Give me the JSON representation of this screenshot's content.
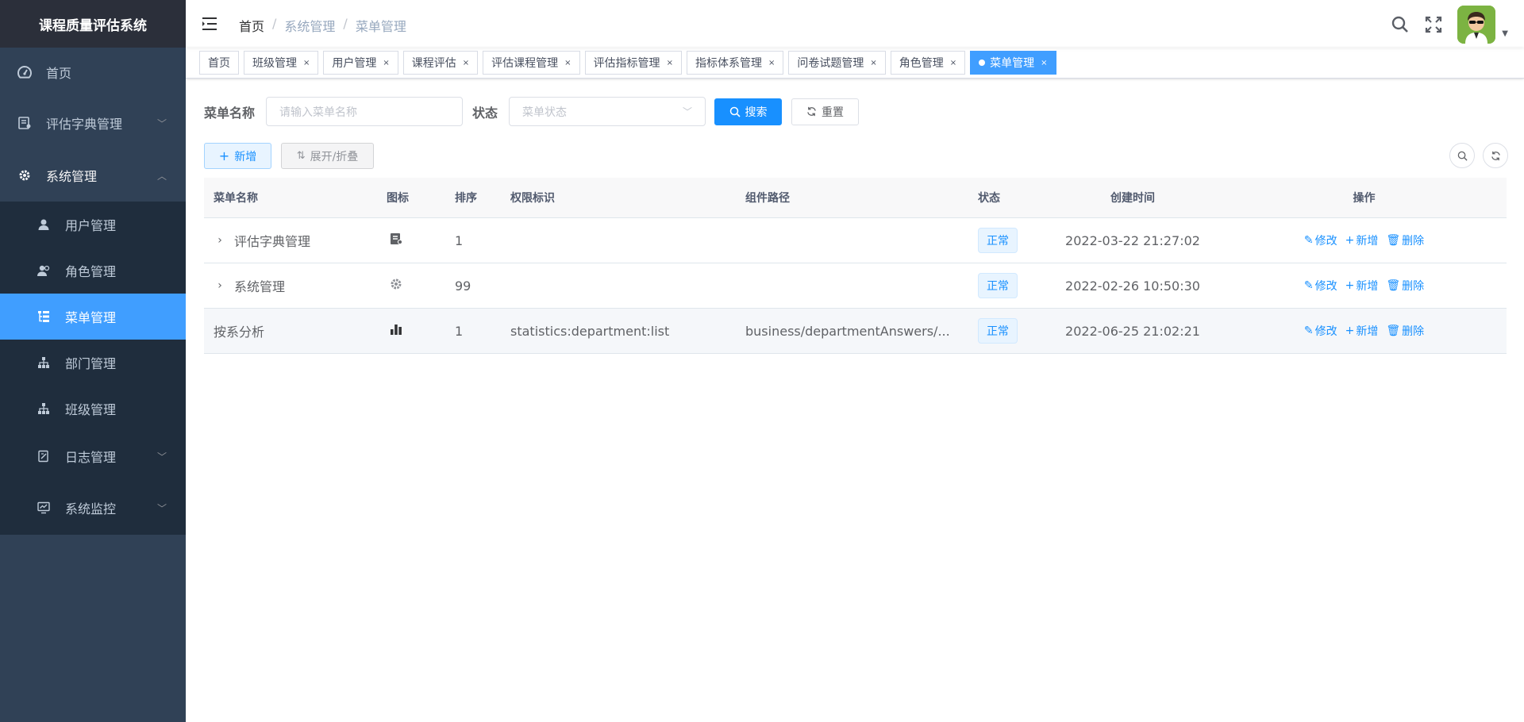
{
  "sidebar": {
    "logo": "课程质量评估系统",
    "items": [
      {
        "label": "首页",
        "icon": "dashboard-icon"
      },
      {
        "label": "评估字典管理",
        "icon": "dict-icon",
        "arrow": "﹀"
      },
      {
        "label": "系统管理",
        "icon": "gear-icon",
        "arrow": "︿"
      }
    ],
    "sub": [
      {
        "label": "用户管理",
        "icon": "user-icon"
      },
      {
        "label": "角色管理",
        "icon": "peoples-icon"
      },
      {
        "label": "菜单管理",
        "icon": "tree-table-icon"
      },
      {
        "label": "部门管理",
        "icon": "tree-icon"
      },
      {
        "label": "班级管理",
        "icon": "tree-icon"
      }
    ],
    "bottom": [
      {
        "label": "日志管理",
        "icon": "log-icon",
        "arrow": "﹀"
      },
      {
        "label": "系统监控",
        "icon": "monitor-icon",
        "arrow": "﹀"
      }
    ]
  },
  "breadcrumb": {
    "home": "首页",
    "sep": "/",
    "level1": "系统管理",
    "level2": "菜单管理"
  },
  "tags": [
    {
      "label": "首页"
    },
    {
      "label": "班级管理"
    },
    {
      "label": "用户管理"
    },
    {
      "label": "课程评估"
    },
    {
      "label": "评估课程管理"
    },
    {
      "label": "评估指标管理"
    },
    {
      "label": "指标体系管理"
    },
    {
      "label": "问卷试题管理"
    },
    {
      "label": "角色管理"
    },
    {
      "label": "菜单管理"
    }
  ],
  "tag_close": "×",
  "search": {
    "name_label": "菜单名称",
    "name_placeholder": "请输入菜单名称",
    "status_label": "状态",
    "status_placeholder": "菜单状态",
    "search_btn": "搜索",
    "reset_btn": "重置"
  },
  "toolbar": {
    "add": "新增",
    "expand": "展开/折叠"
  },
  "table": {
    "headers": [
      "菜单名称",
      "图标",
      "排序",
      "权限标识",
      "组件路径",
      "状态",
      "创建时间",
      "操作"
    ],
    "rows": [
      {
        "name": "评估字典管理",
        "icon": "dict-icon",
        "sort": "1",
        "perm": "",
        "path": "",
        "status": "正常",
        "time": "2022-03-22 21:27:02"
      },
      {
        "name": "系统管理",
        "icon": "gear-icon",
        "sort": "99",
        "perm": "",
        "path": "",
        "status": "正常",
        "time": "2022-02-26 10:50:30"
      },
      {
        "name": "按系分析",
        "icon": "bar-chart-icon",
        "sort": "1",
        "perm": "statistics:department:list",
        "path": "business/departmentAnswers/...",
        "status": "正常",
        "time": "2022-06-25 21:02:21"
      }
    ],
    "ops": {
      "edit": "修改",
      "add": "新增",
      "delete": "删除"
    }
  },
  "colors": {
    "sidebar": "#304156",
    "active": "#409eff",
    "primary": "#1890ff"
  }
}
